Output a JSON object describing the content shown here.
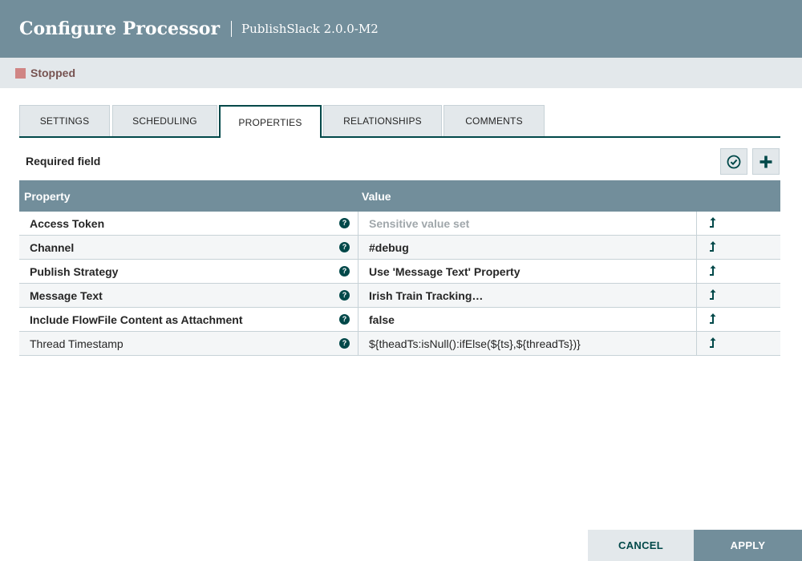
{
  "dialog": {
    "title": "Configure Processor",
    "subtitle": "PublishSlack 2.0.0-M2"
  },
  "status": {
    "label": "Stopped",
    "color": "#d08584"
  },
  "tabs": [
    {
      "label": "SETTINGS",
      "active": false
    },
    {
      "label": "SCHEDULING",
      "active": false
    },
    {
      "label": "PROPERTIES",
      "active": true
    },
    {
      "label": "RELATIONSHIPS",
      "active": false
    },
    {
      "label": "COMMENTS",
      "active": false
    }
  ],
  "toolbar": {
    "required_label": "Required field",
    "verify_icon": "check-circle-icon",
    "add_icon": "plus-icon"
  },
  "table": {
    "headers": {
      "property": "Property",
      "value": "Value"
    },
    "rows": [
      {
        "name": "Access Token",
        "value": "Sensitive value set",
        "required": true,
        "sensitive": true
      },
      {
        "name": "Channel",
        "value": "#debug",
        "required": true,
        "sensitive": false
      },
      {
        "name": "Publish Strategy",
        "value": "Use 'Message Text' Property",
        "required": true,
        "sensitive": false
      },
      {
        "name": "Message Text",
        "value": "Irish Train Tracking…",
        "required": true,
        "sensitive": false
      },
      {
        "name": "Include FlowFile Content as Attachment",
        "value": "false",
        "required": true,
        "sensitive": false
      },
      {
        "name": "Thread Timestamp",
        "value": "${theadTs:isNull():ifElse(${ts},${threadTs})}",
        "required": false,
        "sensitive": false
      }
    ],
    "help_icon": "question-circle-icon",
    "goto_icon": "level-up-arrow-icon"
  },
  "footer": {
    "cancel_label": "CANCEL",
    "apply_label": "APPLY"
  },
  "colors": {
    "header": "#728e9b",
    "accent": "#004849",
    "status_bar": "#e3e8eb"
  }
}
